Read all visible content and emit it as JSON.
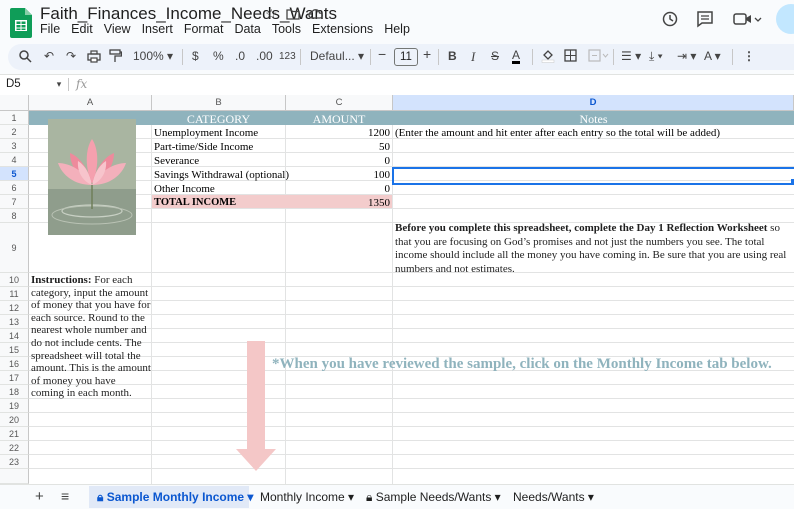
{
  "app": {
    "title": "Faith_Finances_Income_Needs_Wants",
    "menu": [
      "File",
      "Edit",
      "View",
      "Insert",
      "Format",
      "Data",
      "Tools",
      "Extensions",
      "Help"
    ]
  },
  "toolbar": {
    "zoom": "100%",
    "currency": "$",
    "percent": "%",
    "number_format": "123",
    "font": "Defaul...",
    "font_size": "11"
  },
  "formula_bar": {
    "name_box": "D5",
    "fx": "fx"
  },
  "columns": [
    "A",
    "B",
    "C",
    "D"
  ],
  "rows": [
    "1",
    "2",
    "3",
    "4",
    "5",
    "6",
    "7",
    "8",
    "9",
    "10",
    "11",
    "12",
    "13",
    "14",
    "15",
    "16",
    "17",
    "18",
    "19",
    "20",
    "21",
    "22",
    "23"
  ],
  "sheet": {
    "headers": {
      "category": "CATEGORY",
      "amount": "AMOUNT",
      "notes": "Notes"
    },
    "items": [
      {
        "category": "Unemployment Income",
        "amount": "1200"
      },
      {
        "category": "Part-time/Side Income",
        "amount": "50"
      },
      {
        "category": "Severance",
        "amount": "0"
      },
      {
        "category": "Savings Withdrawal (optional)",
        "amount": "100"
      },
      {
        "category": "Other Income",
        "amount": "0"
      }
    ],
    "total": {
      "label": "TOTAL INCOME",
      "amount": "1350"
    },
    "note_row2": "(Enter the amount and hit enter after each entry so the total will be added)",
    "note_row9_bold": "Before you complete this spreadsheet, complete the Day 1 Reflection Worksheet",
    "note_row9_rest": " so that you are focusing on God’s promises and not just the numbers you see. The total income should include all the money you have coming in. Be sure that you are using real numbers and not estimates.",
    "instructions_bold": "Instructions:",
    "instructions_rest": " For each category, input the amount of money that you have for each source. Round to the nearest whole number and do not include cents. The spreadsheet will total the amount. This is the amount of money you have coming in each month.",
    "review_text": "*When you have reviewed the sample, click on the Monthly Income tab below."
  },
  "tabs": [
    {
      "label": "Sample Monthly Income",
      "locked": true,
      "active": true
    },
    {
      "label": "Monthly Income",
      "locked": false,
      "active": false
    },
    {
      "label": "Sample Needs/Wants",
      "locked": true,
      "active": false
    },
    {
      "label": "Needs/Wants",
      "locked": false,
      "active": false
    }
  ],
  "colors": {
    "accent": "#1a73e8",
    "header_teal": "#8fb3bd",
    "total_pink": "#f3cccc",
    "sheets_green": "#0f9d58"
  },
  "icons": [
    "star-icon",
    "folder-move-icon",
    "cloud-status-icon",
    "history-icon",
    "comment-icon",
    "video-call-icon",
    "search-icon",
    "undo-icon",
    "redo-icon",
    "print-icon",
    "paint-format-icon",
    "bold-icon",
    "italic-icon",
    "strikethrough-icon",
    "text-color-icon",
    "fill-color-icon",
    "borders-icon",
    "merge-icon",
    "align-icon",
    "valign-icon",
    "wrap-icon",
    "rotate-icon",
    "more-icon",
    "lock-icon",
    "add-sheet-icon",
    "all-sheets-icon",
    "lotus-image"
  ]
}
